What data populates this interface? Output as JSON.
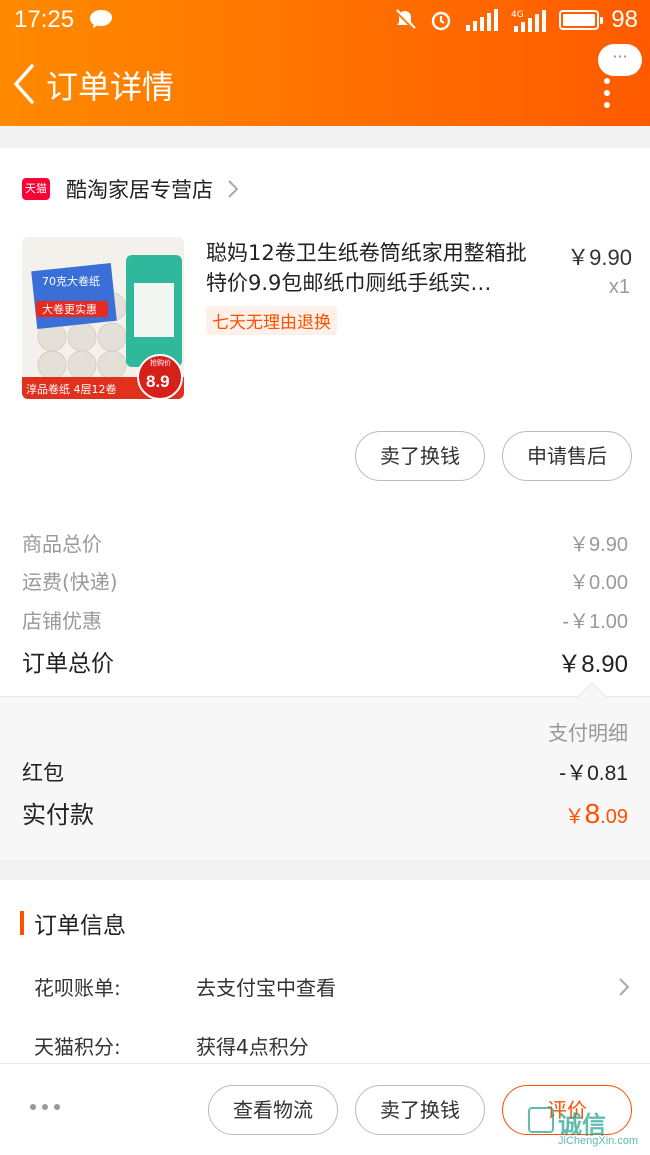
{
  "status_bar": {
    "time": "17:25",
    "battery": "98",
    "network": "4G"
  },
  "nav": {
    "title": "订单详情",
    "bubble": "···"
  },
  "shop": {
    "badge": "天猫",
    "name": "酷淘家居专营店"
  },
  "product": {
    "title": "聪妈12卷卫生纸卷筒纸家用整箱批特价9.9包邮纸巾厕纸手纸实…",
    "price": "￥9.90",
    "qty": "x1",
    "tag": "七天无理由退换",
    "image": {
      "top_text": "70克大卷纸",
      "sub_text": "大卷更实惠",
      "bottom_text": "淳品卷纸 4层12卷",
      "price_tag": "8.9",
      "price_label": "抢购价"
    }
  },
  "actions": {
    "sell": "卖了换钱",
    "after_sale": "申请售后"
  },
  "summary": [
    {
      "label": "商品总价",
      "value": "￥9.90"
    },
    {
      "label": "运费(快递)",
      "value": "￥0.00"
    },
    {
      "label": "店铺优惠",
      "value": "-￥1.00"
    }
  ],
  "total": {
    "label": "订单总价",
    "value": "￥8.90"
  },
  "payment": {
    "detail_label": "支付明细",
    "red_packet_label": "红包",
    "red_packet_value": "-￥0.81",
    "actual_label": "实付款",
    "actual_currency": "￥",
    "actual_int": "8",
    "actual_dec": ".09"
  },
  "order_info": {
    "title": "订单信息",
    "rows": [
      {
        "key": "花呗账单:",
        "value": "去支付宝中查看"
      },
      {
        "key": "天猫积分:",
        "value": "获得4点积分"
      }
    ]
  },
  "bottom_bar": {
    "logistics": "查看物流",
    "sell": "卖了换钱",
    "review": "评价"
  },
  "watermark": {
    "text": "诚信",
    "sub": "JiChengXin.com"
  },
  "colors": {
    "accent": "#ff5000",
    "header_start": "#ff8a00",
    "header_end": "#ff5a00",
    "tmall_red": "#ff0036"
  }
}
